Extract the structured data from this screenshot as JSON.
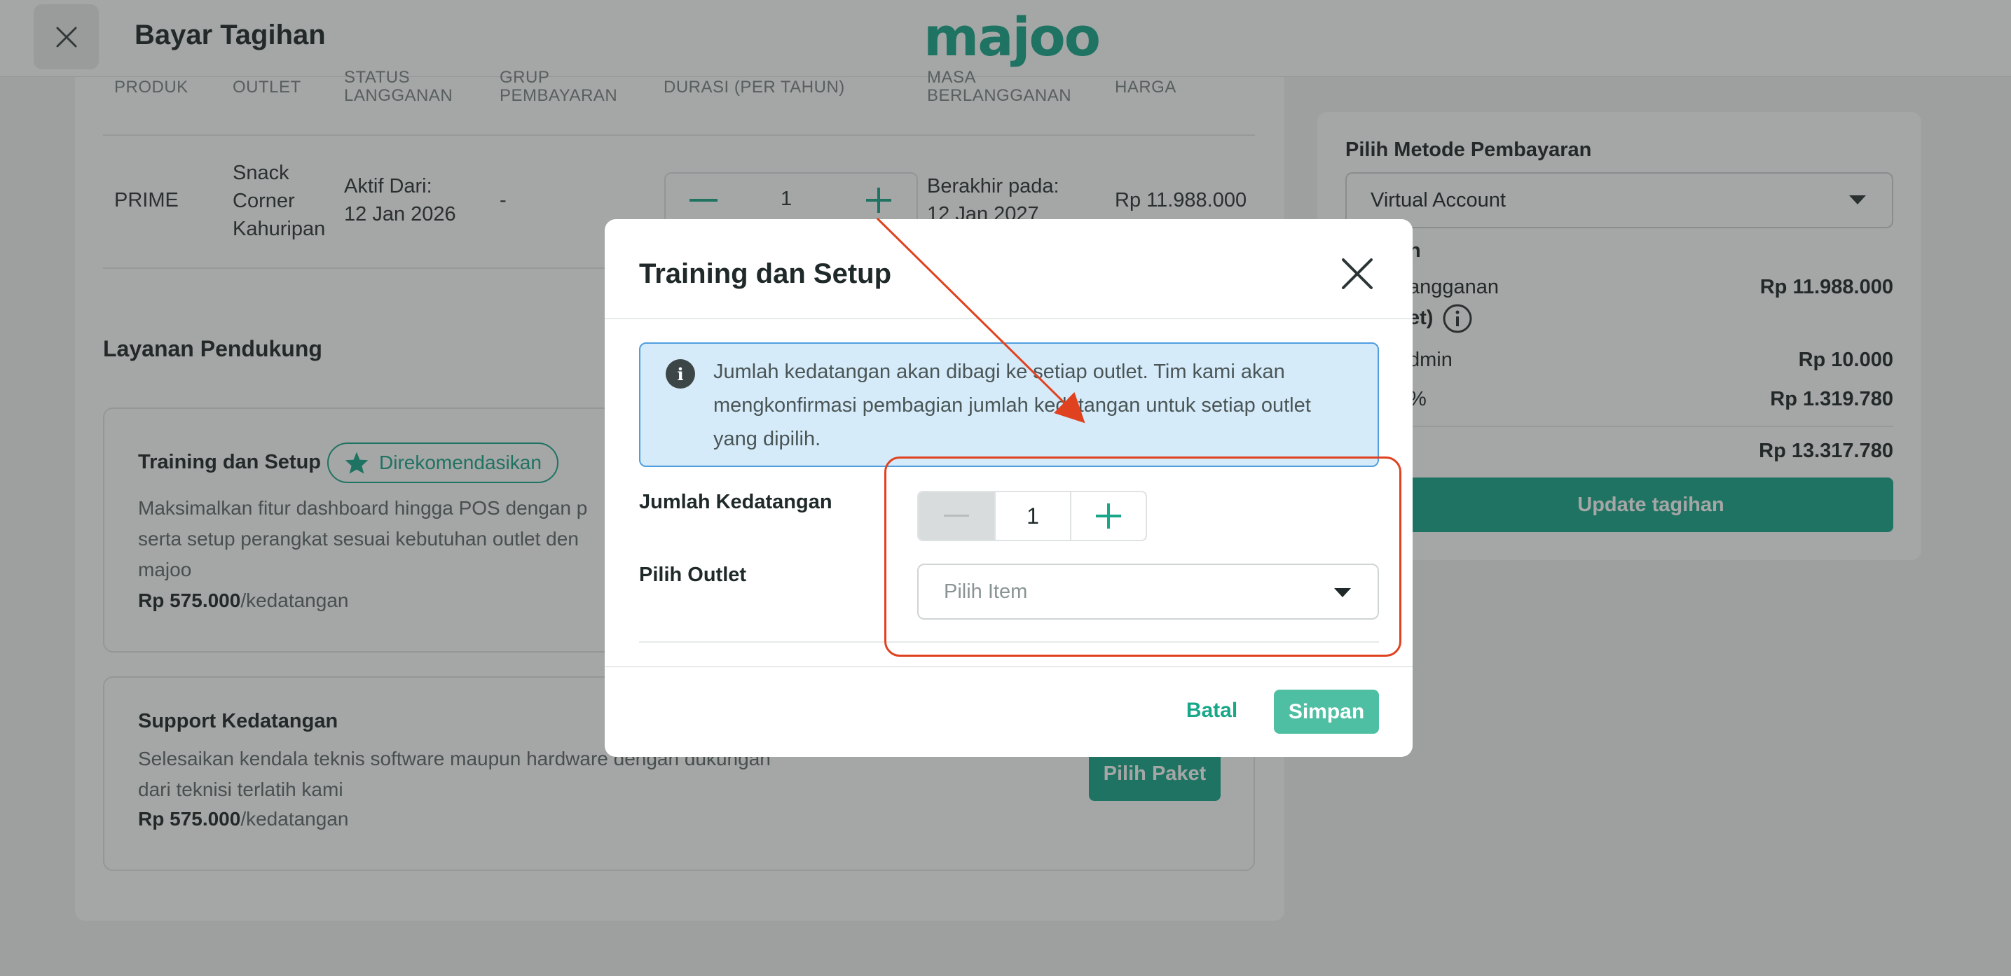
{
  "header": {
    "title": "Bayar Tagihan",
    "logo": "majoo"
  },
  "table": {
    "columns": [
      "PRODUK",
      "OUTLET",
      "STATUS\nLANGGANAN",
      "GRUP\nPEMBAYARAN",
      "DURASI (PER TAHUN)",
      "MASA\nBERLANGGANAN",
      "HARGA"
    ],
    "row": {
      "produk": "PRIME",
      "outlet": "Snack\nCorner\nKahuripan",
      "status": "Aktif Dari:\n12 Jan 2026",
      "grup": "-",
      "durasi": "1",
      "masa": "Berakhir pada:\n12 Jan 2027",
      "harga": "Rp 11.988.000"
    }
  },
  "support": {
    "title": "Layanan Pendukung",
    "training": {
      "title": "Training dan Setup",
      "badge": "Direkomendasikan",
      "desc": "Maksimalkan fitur dashboard hingga POS dengan p\nserta setup perangkat sesuai kebutuhan outlet den\nmajoo",
      "price": "Rp 575.000",
      "unit": "/kedatangan"
    },
    "kedatangan": {
      "title": "Support Kedatangan",
      "desc": "Selesaikan kendala teknis software maupun hardware dengan dukungan\ndari teknisi terlatih kami",
      "price": "Rp 575.000",
      "unit": "/kedatangan",
      "button": "Pilih Paket"
    }
  },
  "payment": {
    "label": "Pilih Metode Pembayaran",
    "method": "Virtual Account",
    "partial_heading": "n",
    "rows": [
      {
        "label": "angganan",
        "value": "Rp 11.988.000"
      },
      {
        "label": "et)",
        "value": ""
      },
      {
        "label": "dmin",
        "value": "Rp 10.000"
      },
      {
        "label": "%",
        "value": "Rp 1.319.780"
      },
      {
        "label": "",
        "value": "Rp 13.317.780"
      }
    ],
    "button": "Update tagihan"
  },
  "modal": {
    "title": "Training dan Setup",
    "info": "Jumlah kedatangan akan dibagi ke setiap outlet. Tim kami akan mengkonfirmasi pembagian jumlah kedatangan untuk setiap outlet yang dipilih.",
    "jumlah_label": "Jumlah Kedatangan",
    "jumlah_value": "1",
    "outlet_label": "Pilih Outlet",
    "outlet_placeholder": "Pilih Item",
    "cancel": "Batal",
    "save": "Simpan"
  },
  "colors": {
    "brand": "#19a78a",
    "annotation": "#e0421f",
    "info_bg": "#d6ebfa"
  }
}
